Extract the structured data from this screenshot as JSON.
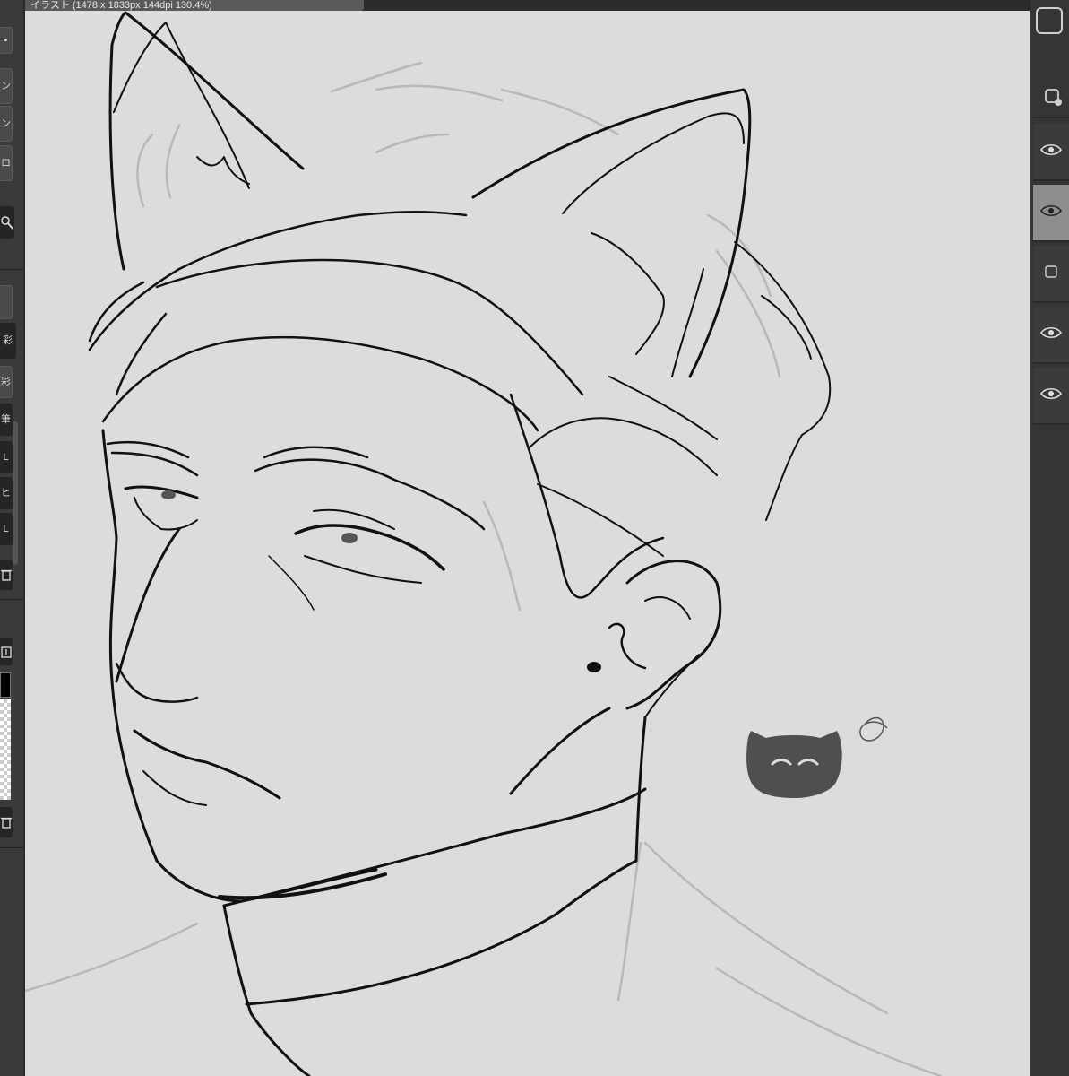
{
  "window": {
    "title": "イラスト (1478 x 1833px 144dpi 130.4%)"
  },
  "left_toolbar": {
    "buttons": [
      "彩",
      "彩",
      "筆",
      "L",
      "ヒ",
      "L"
    ]
  },
  "canvas": {
    "background": "#dcdcdc",
    "line_color": "#111111",
    "sketch_color": "#b9b9b9",
    "stamp_color": "#4f4f4f"
  },
  "layers": [
    {
      "visible": true,
      "selected": false
    },
    {
      "visible": true,
      "selected": true
    },
    {
      "visible": false,
      "selected": false
    },
    {
      "visible": true,
      "selected": false
    },
    {
      "visible": true,
      "selected": false
    }
  ]
}
